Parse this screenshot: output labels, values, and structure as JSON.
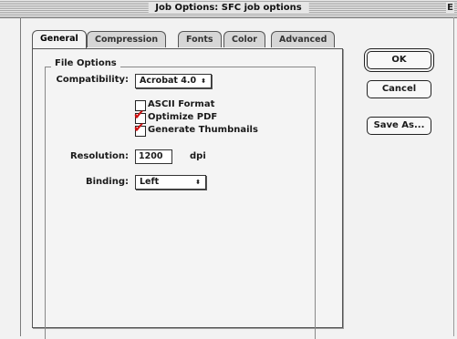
{
  "window": {
    "title": "Job Options: SFC job options",
    "edge_glyph": "E"
  },
  "tabs": [
    {
      "label": "General",
      "active": true
    },
    {
      "label": "Compression",
      "active": false
    },
    {
      "label": "Fonts",
      "active": false
    },
    {
      "label": "Color",
      "active": false
    },
    {
      "label": "Advanced",
      "active": false
    }
  ],
  "general": {
    "group_title": "File Options",
    "compatibility": {
      "label": "Compatibility:",
      "value": "Acrobat 4.0"
    },
    "checkboxes": [
      {
        "label": "ASCII Format",
        "checked": false
      },
      {
        "label": "Optimize PDF",
        "checked": true
      },
      {
        "label": "Generate Thumbnails",
        "checked": true
      }
    ],
    "resolution": {
      "label": "Resolution:",
      "value": "1200",
      "unit": "dpi"
    },
    "binding": {
      "label": "Binding:",
      "value": "Left"
    }
  },
  "buttons": {
    "ok": "OK",
    "cancel": "Cancel",
    "save_as": "Save As..."
  },
  "icons": {
    "popup_arrow": "updown-arrows-icon",
    "check": "red-checkmark-icon"
  },
  "colors": {
    "checkmark": "#d01010"
  }
}
